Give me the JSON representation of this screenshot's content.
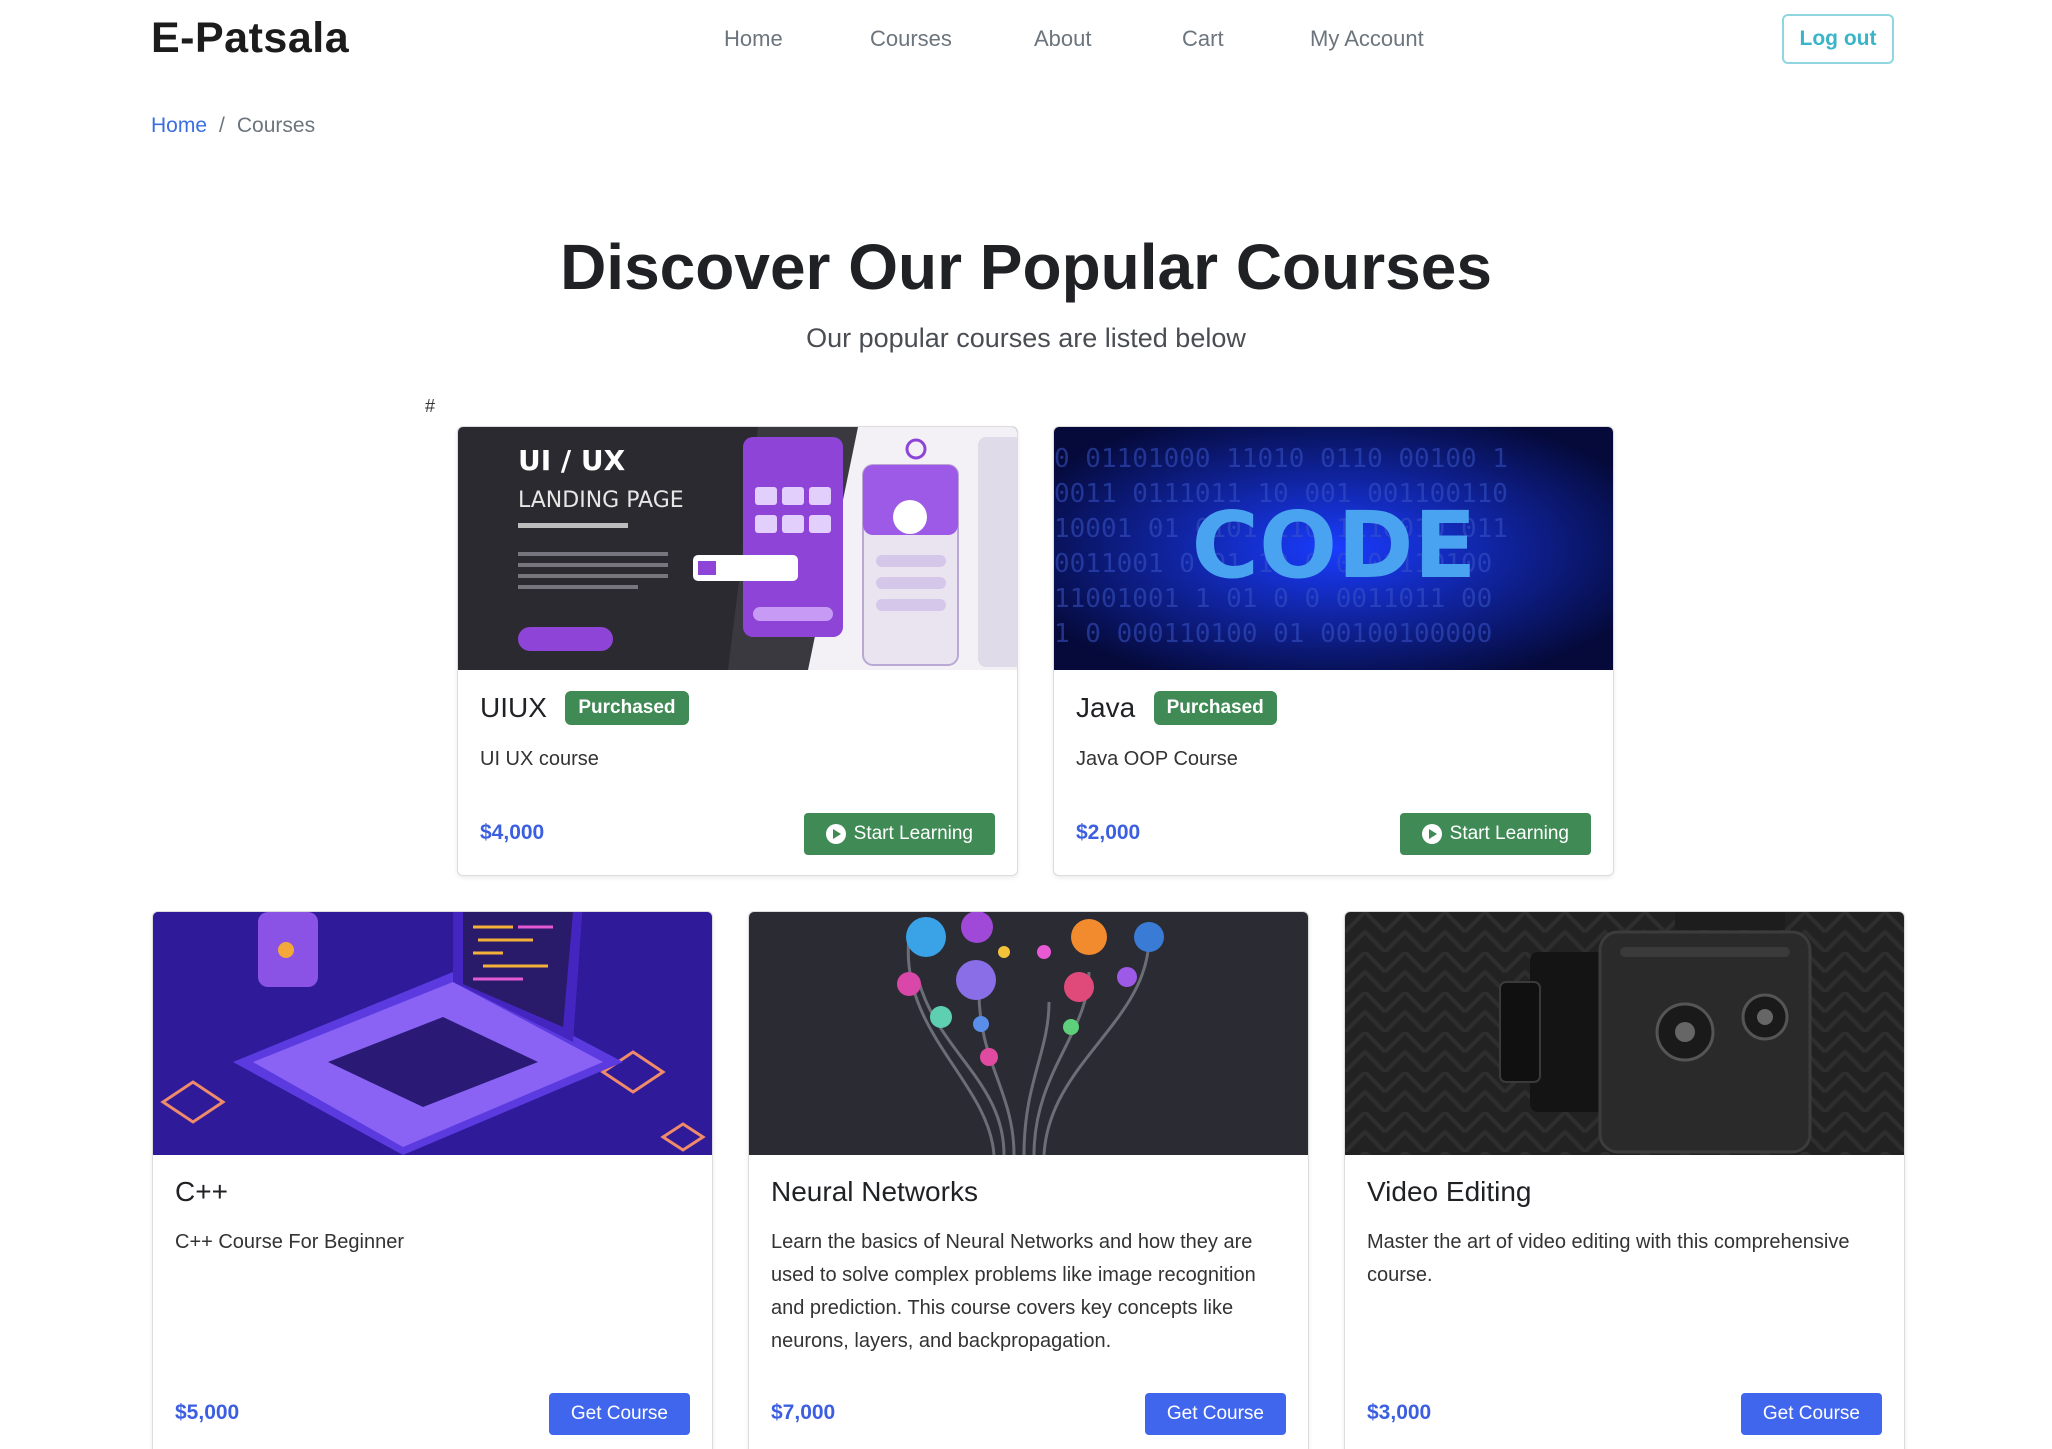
{
  "brand": "E-Patsala",
  "nav": {
    "home": "Home",
    "courses": "Courses",
    "about": "About",
    "cart": "Cart",
    "account": "My Account",
    "logout": "Log out"
  },
  "breadcrumb": {
    "home": "Home",
    "separator": "/",
    "current": "Courses"
  },
  "hero": {
    "title": "Discover Our Popular Courses",
    "subtitle": "Our popular courses are listed below",
    "stray_text": "#"
  },
  "courses": [
    {
      "title": "UIUX",
      "badge": "Purchased",
      "description": "UI UX course",
      "price": "$4,000",
      "action": "Start Learning",
      "image_text": {
        "line1": "UI / UX",
        "line2": "LANDING PAGE"
      }
    },
    {
      "title": "Java",
      "badge": "Purchased",
      "description": "Java OOP Course",
      "price": "$2,000",
      "action": "Start Learning",
      "image_text": {
        "word": "CODE"
      }
    },
    {
      "title": "C++",
      "description": "C++ Course For Beginner",
      "price": "$5,000",
      "action": "Get Course"
    },
    {
      "title": "Neural Networks",
      "description": "Learn the basics of Neural Networks and how they are used to solve complex problems like image recognition and prediction. This course covers key concepts like neurons, layers, and backpropagation.",
      "price": "$7,000",
      "action": "Get Course"
    },
    {
      "title": "Video Editing",
      "description": "Master the art of video editing with this comprehensive course.",
      "price": "$3,000",
      "action": "Get Course"
    }
  ],
  "colors": {
    "purchased": "#3f8a55",
    "primary_button": "#4166ee",
    "price": "#3b5fe0",
    "logout_border": "#8fd6e0"
  }
}
